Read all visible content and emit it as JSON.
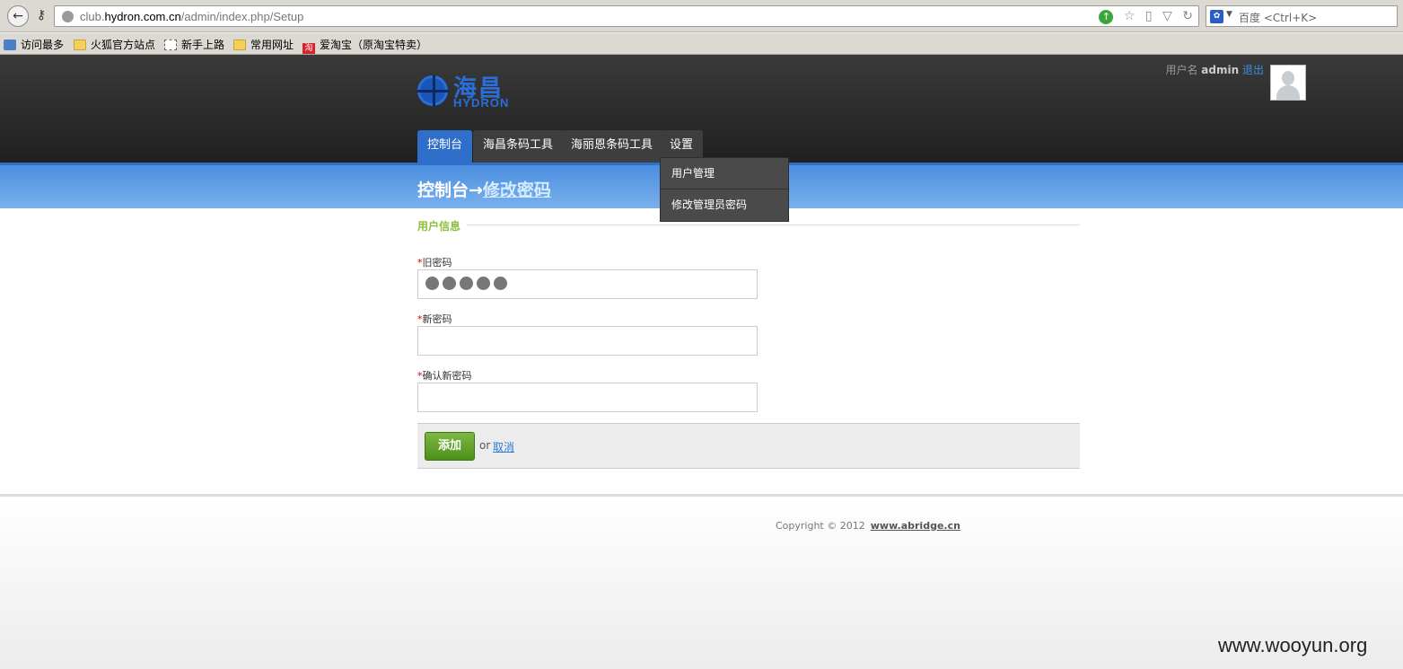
{
  "browser": {
    "url_host_prefix": "club.",
    "url_host": "hydron.com.cn",
    "url_path": "/admin/index.php/Setup",
    "search_engine_icon": "paw-icon",
    "search_placeholder": "百度 <Ctrl+K>",
    "bookmarks": [
      {
        "label": "访问最多",
        "icon": "most-visited-icon"
      },
      {
        "label": "火狐官方站点",
        "icon": "folder-icon"
      },
      {
        "label": "新手上路",
        "icon": "blank-page-icon"
      },
      {
        "label": "常用网址",
        "icon": "folder-icon"
      },
      {
        "label": "爱淘宝（原淘宝特卖）",
        "icon": "taobao-icon",
        "icon_text": "淘"
      }
    ]
  },
  "header": {
    "logo_cn": "海昌",
    "logo_en": "HYDRON",
    "username_label": "用户名",
    "username": "admin",
    "logout": "退出",
    "nav": [
      {
        "label": "控制台",
        "active": true
      },
      {
        "label": "海昌条码工具",
        "active": false
      },
      {
        "label": "海丽恩条码工具",
        "active": false
      },
      {
        "label": "设置",
        "active": false
      }
    ],
    "dropdown": [
      "用户管理",
      "修改管理员密码"
    ]
  },
  "title": {
    "main": "控制台→",
    "sub": "修改密码"
  },
  "form": {
    "legend": "用户信息",
    "required_mark": "*",
    "fields": [
      {
        "label": "旧密码",
        "masked_chars": 5
      },
      {
        "label": "新密码",
        "value": ""
      },
      {
        "label": "确认新密码",
        "value": ""
      }
    ],
    "submit": "添加",
    "or": "or",
    "cancel": "取消"
  },
  "footer": {
    "copyright": "Copyright © 2012",
    "site": "www.abridge.cn"
  },
  "watermark": "www.wooyun.org",
  "colors": {
    "accent_blue": "#2f6fc9",
    "legend_green": "#8dc03c",
    "button_green": "#5fa02a"
  }
}
